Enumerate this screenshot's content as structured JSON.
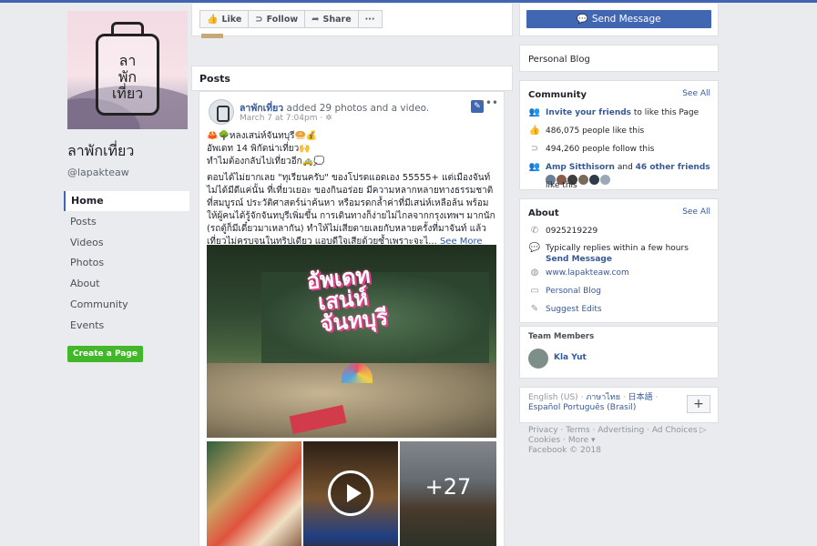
{
  "page": {
    "name": "ลาพักเที่ยว",
    "handle": "@lapakteaw",
    "logo_text": [
      "ลา",
      "พัก",
      "เที่ยว"
    ]
  },
  "nav": [
    {
      "label": "Home",
      "active": true
    },
    {
      "label": "Posts"
    },
    {
      "label": "Videos"
    },
    {
      "label": "Photos"
    },
    {
      "label": "About"
    },
    {
      "label": "Community"
    },
    {
      "label": "Events"
    }
  ],
  "create_page_label": "Create a Page",
  "actions": {
    "like": "Like",
    "follow": "Follow",
    "share": "Share",
    "more": "···",
    "send_message": "Send Message"
  },
  "posts_header": "Posts",
  "post": {
    "author": "ลาพักเที่ยว",
    "action_text": "added 29 photos and a video.",
    "date": "March 7 at 7:04pm",
    "privacy_icon": "globe-icon",
    "lines": [
      "🦀🌳หลงเสน่ห์จันทบุรี🥯💰",
      "อัพเดท 14 พิกัดน่าเที่ยว🙌",
      "ทำไมต้องกลับไปเที่ยวอีก🚕💭"
    ],
    "body": "ตอบได้ไม่ยากเลย \"ทุเรียนครับ\" ของโปรดแอดเอง 55555+ แต่เมืองจันท์ไม่ได้มีดีแค่นั้น ที่เที่ยวเยอะ ของกินอร่อย มีความหลากหลายทางธรรมชาติที่สมบูรณ์ ประวัติศาสตร์น่าค้นหา หรือมรดกล้ำค่าที่มีเสน่ห์เหลือล้น พร้อมให้ผู้คนได้รู้จักจันทบุรีเพิ่มขึ้น การเดินทางก็ง่ายไม่ไกลจากกรุงเทพฯ มากนัก (รถตู้ก็มีเดี๋ยวมาเหลากัน) ทำให้ไม่เสียดายเลยกับหลายครั้งที่มาจันท์ แล้วเที่ยวไม่ครบจนในทริปเดียว แอบดีใจเสียด้วยซ้ำเพราะจะไ...",
    "see_more": "See More",
    "photo_title_1": "อัพเดท",
    "photo_title_2": "เสน่ห์",
    "photo_title_3": "จันทบุรี",
    "more_photos": "+27"
  },
  "right": {
    "personal_blog": "Personal Blog",
    "community": {
      "title": "Community",
      "see_all": "See All",
      "invite_link": "Invite your friends",
      "invite_rest": "to like this Page",
      "likes": "486,075 people like this",
      "follows": "494,260 people follow this",
      "friend_name": "Amp Sitthisorn",
      "and": "and",
      "other_friends": "46 other friends",
      "like_this": "like this"
    },
    "about": {
      "title": "About",
      "see_all": "See All",
      "phone": "0925219229",
      "replies": "Typically replies within a few hours",
      "send_message": "Send Message",
      "website": "www.lapakteaw.com",
      "category": "Personal Blog",
      "suggest": "Suggest Edits"
    },
    "team": {
      "title": "Team Members",
      "member": "Kla Yut"
    },
    "languages": {
      "current": "English (US)",
      "others": [
        "ภาษาไทย",
        "日本語",
        "Español",
        "Português (Brasil)"
      ],
      "sep": "·"
    },
    "footer": {
      "line1": [
        "Privacy",
        "Terms",
        "Advertising",
        "Ad Choices"
      ],
      "line2": [
        "Cookies",
        "More"
      ],
      "copyright": "Facebook © 2018"
    }
  },
  "colors": {
    "brand": "#4267b2",
    "link": "#365899",
    "create_button": "#42b72a"
  }
}
